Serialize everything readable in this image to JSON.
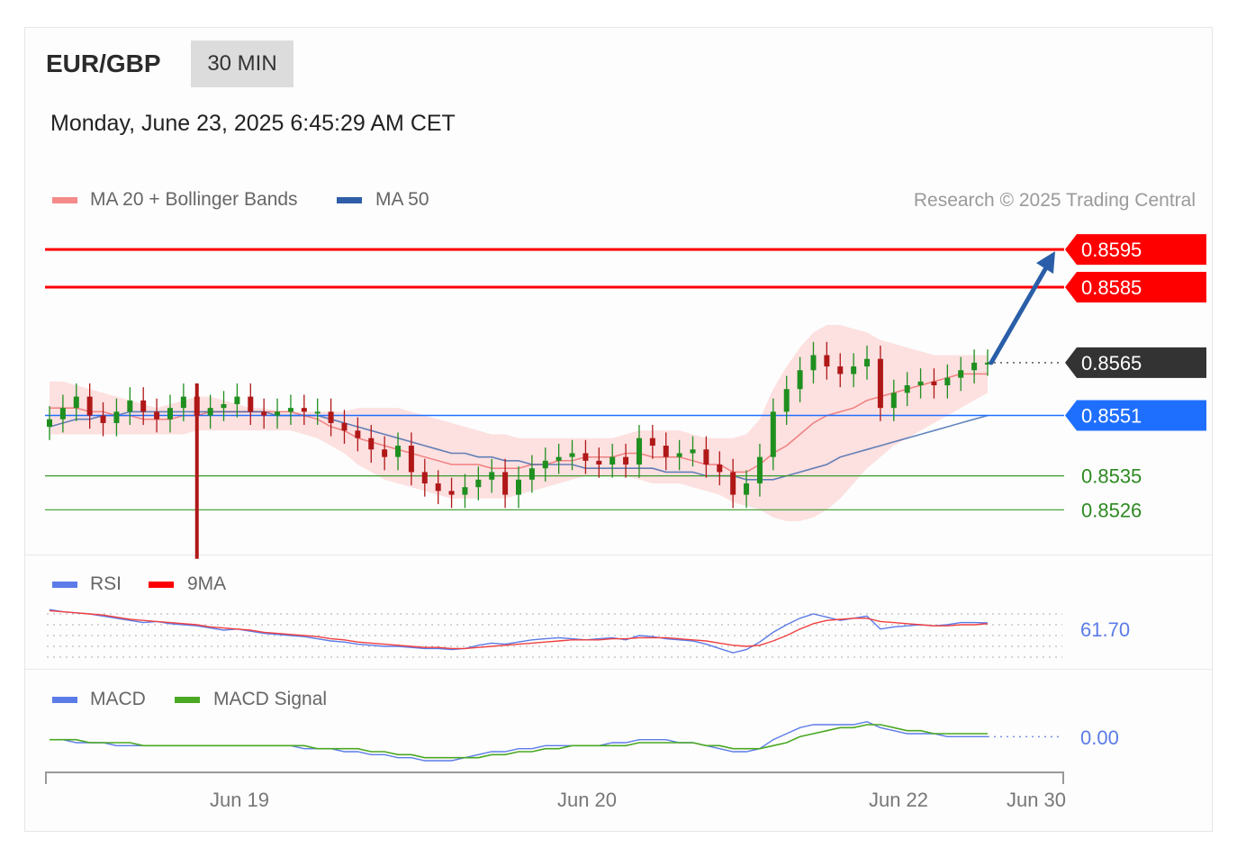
{
  "header": {
    "pair": "EUR/GBP",
    "interval": "30 MIN",
    "datetime": "Monday, June 23, 2025 6:45:29 AM CET"
  },
  "legend": {
    "ma20_label": "MA 20 + Bollinger Bands",
    "ma50_label": "MA 50",
    "copyright": "Research © 2025 Trading Central",
    "rsi_label": "RSI",
    "rsi_ma_label": "9MA",
    "macd_label": "MACD",
    "macd_signal_label": "MACD Signal"
  },
  "colors": {
    "ma20": "#f08080",
    "ma50": "#2f5da8",
    "resistance": "#ff0000",
    "support": "#3a9a2a",
    "pivot": "#1f6fff",
    "last_price_badge": "#333333",
    "candle_up": "#1f8f1f",
    "candle_down": "#b01818",
    "rsi": "#5b7be8",
    "macd_signal": "#4aa822",
    "arrow": "#2a5ea8"
  },
  "chart_data": [
    {
      "type": "candlestick",
      "panel": "price",
      "ylim": [
        0.8512,
        0.8601
      ],
      "x_ticks": [
        "Jun 19",
        "Jun 20",
        "Jun 22",
        "Jun 30"
      ],
      "levels": {
        "resistance": [
          0.8595,
          0.8585
        ],
        "last_price": 0.8565,
        "pivot": 0.8551,
        "support": [
          0.8535,
          0.8526
        ]
      },
      "level_labels": {
        "r1": "0.8595",
        "r2": "0.8585",
        "last": "0.8565",
        "pivot": "0.8551",
        "s1": "0.8535",
        "s2": "0.8526"
      },
      "close_series": [
        0.855,
        0.8553,
        0.8556,
        0.8551,
        0.8549,
        0.8552,
        0.8555,
        0.8552,
        0.855,
        0.8553,
        0.8556,
        0.8551,
        0.8553,
        0.8554,
        0.8556,
        0.8552,
        0.8551,
        0.8552,
        0.8553,
        0.8552,
        0.8552,
        0.8549,
        0.8547,
        0.8545,
        0.8542,
        0.854,
        0.8543,
        0.8536,
        0.8533,
        0.8531,
        0.853,
        0.8532,
        0.8534,
        0.8536,
        0.853,
        0.8534,
        0.8537,
        0.8539,
        0.854,
        0.8541,
        0.8539,
        0.8538,
        0.854,
        0.8538,
        0.8545,
        0.8543,
        0.854,
        0.8541,
        0.8542,
        0.8538,
        0.8536,
        0.853,
        0.8533,
        0.854,
        0.8552,
        0.8558,
        0.8563,
        0.8567,
        0.8564,
        0.8562,
        0.8564,
        0.8566,
        0.8553,
        0.8557,
        0.8559,
        0.856,
        0.8559,
        0.8561,
        0.8563,
        0.8565,
        0.8565
      ],
      "bollinger_upper": [
        0.856,
        0.856,
        0.8559,
        0.8558,
        0.8557,
        0.8556,
        0.8555,
        0.8554,
        0.8553,
        0.8554,
        0.8555,
        0.8556,
        0.8556,
        0.8555,
        0.8554,
        0.8553,
        0.8553,
        0.8552,
        0.8552,
        0.8552,
        0.8552,
        0.8552,
        0.8552,
        0.8553,
        0.8553,
        0.8553,
        0.8553,
        0.8552,
        0.8551,
        0.855,
        0.8549,
        0.8548,
        0.8547,
        0.8546,
        0.8546,
        0.8545,
        0.8545,
        0.8545,
        0.8545,
        0.8545,
        0.8545,
        0.8545,
        0.8545,
        0.8546,
        0.8547,
        0.8547,
        0.8547,
        0.8547,
        0.8546,
        0.8545,
        0.8545,
        0.8545,
        0.8546,
        0.855,
        0.8558,
        0.8564,
        0.8569,
        0.8573,
        0.8575,
        0.8575,
        0.8574,
        0.8573,
        0.8571,
        0.857,
        0.8569,
        0.8568,
        0.8567,
        0.8567,
        0.8567,
        0.8567,
        0.8567
      ],
      "bollinger_lower": [
        0.8546,
        0.8546,
        0.8546,
        0.8546,
        0.8546,
        0.8546,
        0.8546,
        0.8546,
        0.8546,
        0.8546,
        0.8546,
        0.8547,
        0.8547,
        0.8547,
        0.8547,
        0.8547,
        0.8547,
        0.8547,
        0.8547,
        0.8546,
        0.8545,
        0.8543,
        0.8541,
        0.8538,
        0.8536,
        0.8534,
        0.8533,
        0.8532,
        0.8531,
        0.853,
        0.8529,
        0.8529,
        0.8529,
        0.8529,
        0.8529,
        0.853,
        0.8531,
        0.8532,
        0.8533,
        0.8534,
        0.8535,
        0.8535,
        0.8535,
        0.8535,
        0.8534,
        0.8533,
        0.8533,
        0.8533,
        0.8532,
        0.8531,
        0.853,
        0.8528,
        0.8527,
        0.8526,
        0.8524,
        0.8523,
        0.8523,
        0.8524,
        0.8526,
        0.8529,
        0.8533,
        0.8537,
        0.854,
        0.8543,
        0.8545,
        0.8547,
        0.8549,
        0.8551,
        0.8553,
        0.8555,
        0.8557
      ],
      "ma20": [
        0.8553,
        0.8553,
        0.8553,
        0.8552,
        0.8552,
        0.8551,
        0.8551,
        0.855,
        0.855,
        0.855,
        0.8551,
        0.8551,
        0.8552,
        0.8552,
        0.8552,
        0.8552,
        0.8552,
        0.8552,
        0.8552,
        0.8551,
        0.855,
        0.8548,
        0.8547,
        0.8545,
        0.8544,
        0.8543,
        0.8542,
        0.8541,
        0.854,
        0.8539,
        0.8538,
        0.8538,
        0.8538,
        0.8537,
        0.8537,
        0.8537,
        0.8538,
        0.8538,
        0.8539,
        0.8539,
        0.854,
        0.854,
        0.854,
        0.8541,
        0.8541,
        0.854,
        0.854,
        0.854,
        0.8539,
        0.8538,
        0.8538,
        0.8536,
        0.8536,
        0.8538,
        0.8541,
        0.8543,
        0.8546,
        0.8549,
        0.8551,
        0.8552,
        0.8553,
        0.8555,
        0.8556,
        0.8557,
        0.8558,
        0.8559,
        0.856,
        0.8561,
        0.8562,
        0.8562,
        0.8562
      ],
      "ma50": [
        0.8548,
        0.8549,
        0.855,
        0.855,
        0.8551,
        0.8551,
        0.8552,
        0.8552,
        0.8552,
        0.8552,
        0.8552,
        0.8552,
        0.8552,
        0.8552,
        0.8552,
        0.8552,
        0.8552,
        0.8551,
        0.8551,
        0.8551,
        0.8551,
        0.855,
        0.8549,
        0.8548,
        0.8547,
        0.8546,
        0.8545,
        0.8544,
        0.8543,
        0.8542,
        0.8541,
        0.8541,
        0.854,
        0.854,
        0.8539,
        0.8539,
        0.8538,
        0.8538,
        0.8538,
        0.8538,
        0.8537,
        0.8537,
        0.8537,
        0.8537,
        0.8537,
        0.8537,
        0.8536,
        0.8536,
        0.8536,
        0.8535,
        0.8535,
        0.8535,
        0.8534,
        0.8534,
        0.8534,
        0.8535,
        0.8536,
        0.8537,
        0.8538,
        0.854,
        0.8541,
        0.8542,
        0.8543,
        0.8544,
        0.8545,
        0.8546,
        0.8547,
        0.8548,
        0.8549,
        0.855,
        0.8551
      ],
      "projection_target": 0.8595
    },
    {
      "type": "line",
      "panel": "rsi",
      "ylim": [
        25,
        75
      ],
      "last_label": "61.70",
      "rsi": [
        74,
        72,
        71,
        70,
        68,
        66,
        64,
        62,
        63,
        61,
        60,
        59,
        57,
        55,
        56,
        54,
        52,
        51,
        50,
        49,
        47,
        45,
        44,
        42,
        41,
        40,
        40,
        39,
        38,
        38,
        37,
        38,
        41,
        43,
        42,
        44,
        46,
        47,
        48,
        47,
        46,
        47,
        48,
        46,
        50,
        49,
        47,
        46,
        45,
        42,
        38,
        34,
        37,
        44,
        53,
        60,
        66,
        70,
        67,
        64,
        66,
        68,
        56,
        58,
        59,
        60,
        59,
        60,
        62,
        62,
        61.7
      ],
      "rsi_ma": [
        73,
        72,
        71,
        70,
        69,
        67,
        65,
        64,
        63,
        62,
        61,
        60,
        58,
        57,
        56,
        55,
        53,
        52,
        51,
        50,
        49,
        47,
        46,
        44,
        43,
        42,
        41,
        40,
        39,
        39,
        38,
        38,
        39,
        40,
        41,
        42,
        43,
        44,
        45,
        46,
        46,
        46,
        47,
        47,
        48,
        48,
        48,
        47,
        46,
        45,
        43,
        41,
        40,
        41,
        45,
        50,
        56,
        61,
        64,
        65,
        66,
        66,
        63,
        62,
        61,
        60,
        59,
        59,
        60,
        60,
        61
      ]
    },
    {
      "type": "line",
      "panel": "macd",
      "ylim": [
        -0.0009,
        0.0009
      ],
      "last_label": "0.00",
      "macd": [
        0.0001,
        0.0001,
        0.0,
        0.0,
        0.0,
        -0.0001,
        -0.0001,
        -0.0001,
        -0.0001,
        -0.0001,
        -0.0001,
        -0.0001,
        -0.0001,
        -0.0001,
        -0.0001,
        -0.0001,
        -0.0001,
        -0.0001,
        -0.0001,
        -0.0002,
        -0.0002,
        -0.0002,
        -0.0003,
        -0.0003,
        -0.0004,
        -0.0004,
        -0.0005,
        -0.0005,
        -0.0006,
        -0.0006,
        -0.0006,
        -0.0005,
        -0.0004,
        -0.0003,
        -0.0003,
        -0.0002,
        -0.0002,
        -0.0001,
        -0.0001,
        -0.0001,
        -0.0001,
        -0.0001,
        0.0,
        0.0,
        0.0001,
        0.0001,
        0.0001,
        0.0,
        0.0,
        -0.0001,
        -0.0002,
        -0.0003,
        -0.0003,
        -0.0002,
        0.0001,
        0.0003,
        0.0005,
        0.0006,
        0.0006,
        0.0006,
        0.0006,
        0.0007,
        0.0005,
        0.0004,
        0.0003,
        0.0003,
        0.0003,
        0.0002,
        0.0002,
        0.0002,
        0.0002
      ],
      "signal": [
        0.0001,
        0.0001,
        0.0001,
        0.0,
        0.0,
        0.0,
        0.0,
        -0.0001,
        -0.0001,
        -0.0001,
        -0.0001,
        -0.0001,
        -0.0001,
        -0.0001,
        -0.0001,
        -0.0001,
        -0.0001,
        -0.0001,
        -0.0001,
        -0.0001,
        -0.0002,
        -0.0002,
        -0.0002,
        -0.0002,
        -0.0003,
        -0.0003,
        -0.0004,
        -0.0004,
        -0.0005,
        -0.0005,
        -0.0005,
        -0.0005,
        -0.0005,
        -0.0004,
        -0.0004,
        -0.0003,
        -0.0003,
        -0.0002,
        -0.0002,
        -0.0001,
        -0.0001,
        -0.0001,
        -0.0001,
        -0.0001,
        0.0,
        0.0,
        0.0,
        0.0,
        0.0,
        -0.0001,
        -0.0001,
        -0.0002,
        -0.0002,
        -0.0002,
        -0.0001,
        0.0,
        0.0002,
        0.0003,
        0.0004,
        0.0005,
        0.0005,
        0.0006,
        0.0006,
        0.0005,
        0.0004,
        0.0004,
        0.0003,
        0.0003,
        0.0003,
        0.0003,
        0.0003
      ]
    }
  ]
}
